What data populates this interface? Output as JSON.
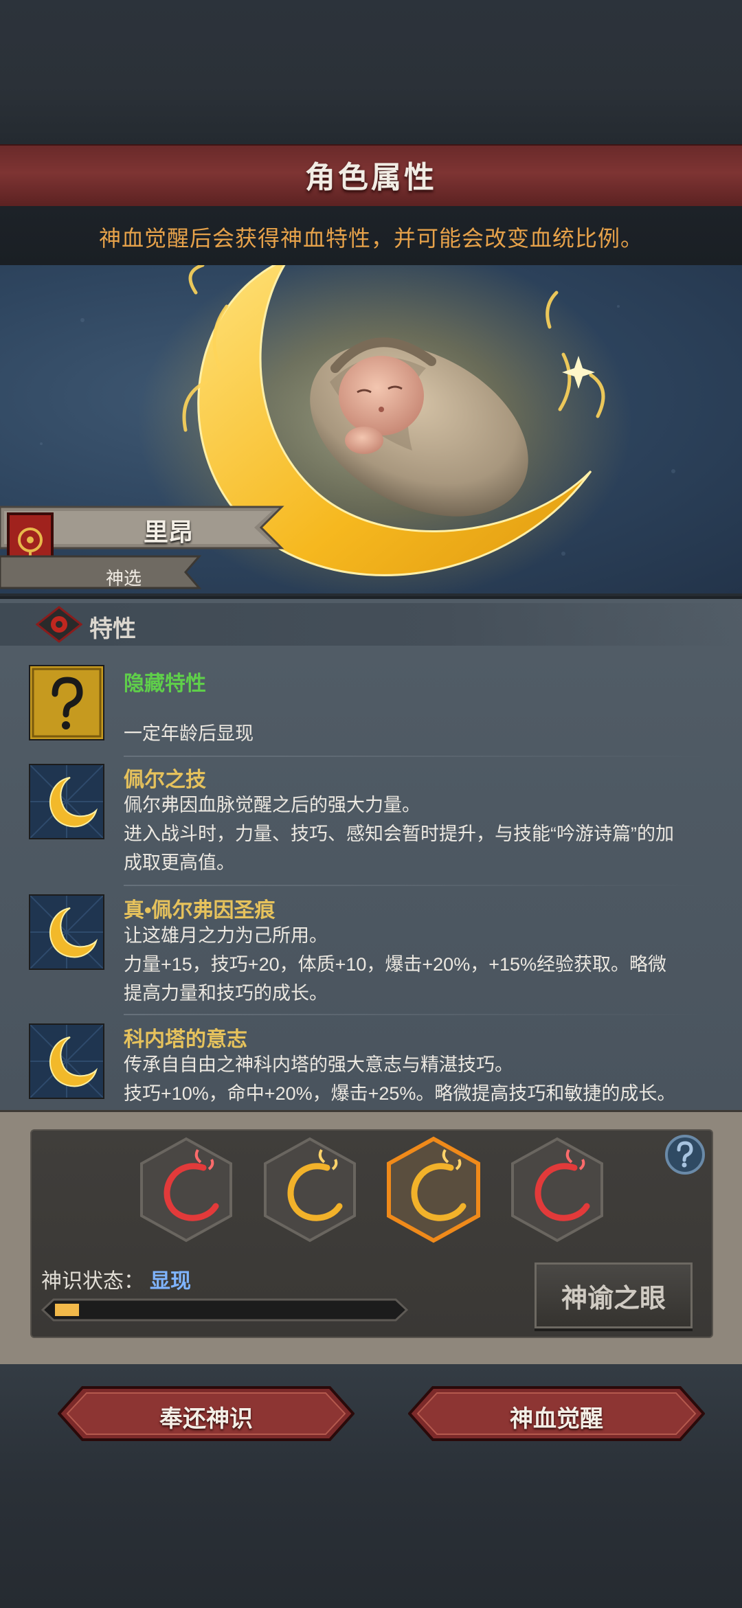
{
  "header": {
    "title": "角色属性",
    "subtitle": "神血觉醒后会获得神血特性，并可能会改变血统比例。"
  },
  "character": {
    "name": "里昂",
    "rank": "神选",
    "portrait_icon": "swaddled-baby-on-golden-crescent-moon"
  },
  "traits_section": {
    "title": "特性",
    "icon": "crimson-sigil-icon",
    "items": [
      {
        "icon": "question-mark-icon",
        "name": "隐藏特性",
        "name_color": "#5fcf4a",
        "lines": [
          "",
          "一定年龄后显现"
        ]
      },
      {
        "icon": "golden-crescent-moon-icon",
        "name": "佩尔之技",
        "name_color": "#e6c25c",
        "lines": [
          "佩尔弗因血脉觉醒之后的强大力量。",
          "进入战斗时，力量、技巧、感知会暂时提升，与技能“吟游诗篇”的加",
          "成取更高值。"
        ]
      },
      {
        "icon": "golden-crescent-moon-icon",
        "name": "真•佩尔弗因圣痕",
        "name_color": "#e6c25c",
        "lines": [
          "让这雄月之力为己所用。",
          "力量+15，技巧+20，体质+10，爆击+20%，+15%经验获取。略微",
          "提高力量和技巧的成长。"
        ]
      },
      {
        "icon": "golden-crescent-moon-icon",
        "name": "科内塔的意志",
        "name_color": "#e6c25c",
        "lines": [
          "传承自自由之神科内塔的强大意志与精湛技巧。",
          "技巧+10%，命中+20%，爆击+25%。略微提高技巧和敏捷的成长。"
        ]
      }
    ]
  },
  "divine_sense": {
    "slots": [
      {
        "icon": "red-crescent-slot-icon",
        "selected": false
      },
      {
        "icon": "gold-crescent-slot-icon",
        "selected": false
      },
      {
        "icon": "gold-crescent-slot-icon",
        "selected": true
      },
      {
        "icon": "red-crescent-slot-icon",
        "selected": false
      }
    ],
    "status_label": "神识状态：",
    "status_value": "显现",
    "progress_fraction": 0.07,
    "oracle_button": "神谕之眼",
    "help_icon": "help-question-icon"
  },
  "actions": {
    "return_label": "奉还神识",
    "awaken_label": "神血觉醒"
  },
  "colors": {
    "banner_red": "#7e3433",
    "subtitle_orange": "#e7a24a",
    "trait_gold": "#e6c25c",
    "hidden_green": "#5fcf4a",
    "status_blue": "#7fb4ff",
    "progress_yellow": "#f2b94a"
  }
}
